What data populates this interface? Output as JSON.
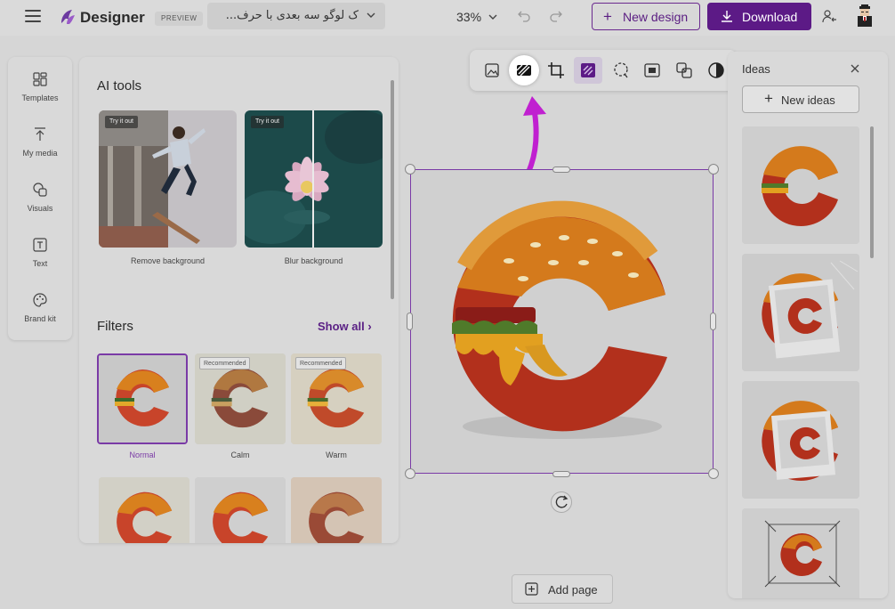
{
  "header": {
    "brand": "Designer",
    "badge": "PREVIEW",
    "design_title": "ک لوگو سه بعدی با حرف...",
    "zoom": "33%",
    "new_design_label": "New design",
    "download_label": "Download"
  },
  "rail": {
    "items": [
      {
        "label": "Templates",
        "icon": "templates-icon"
      },
      {
        "label": "My media",
        "icon": "upload-icon"
      },
      {
        "label": "Visuals",
        "icon": "visuals-icon"
      },
      {
        "label": "Text",
        "icon": "text-icon"
      },
      {
        "label": "Brand kit",
        "icon": "brand-kit-icon"
      }
    ]
  },
  "ai_tools": {
    "title": "AI tools",
    "cards": [
      {
        "badge": "Try it out",
        "label": "Remove background"
      },
      {
        "badge": "Try it out",
        "label": "Blur background"
      }
    ]
  },
  "filters": {
    "title": "Filters",
    "show_all": "Show all",
    "items": [
      {
        "label": "Normal",
        "selected": true,
        "badge": ""
      },
      {
        "label": "Calm",
        "selected": false,
        "badge": "Recommended"
      },
      {
        "label": "Warm",
        "selected": false,
        "badge": "Recommended"
      }
    ]
  },
  "canvas": {
    "toolbar_icons": [
      "image-icon",
      "background-remove-icon",
      "crop-icon",
      "filters-icon",
      "lasso-select-icon",
      "frame-icon",
      "layers-icon",
      "adjust-icon"
    ],
    "active_tool": "background-remove-icon",
    "add_page_label": "Add page"
  },
  "ideas": {
    "title": "Ideas",
    "new_ideas_label": "New ideas"
  },
  "colors": {
    "brand": "#5c1a86",
    "accent": "#7a3aa6",
    "arrow": "#c020d0"
  }
}
